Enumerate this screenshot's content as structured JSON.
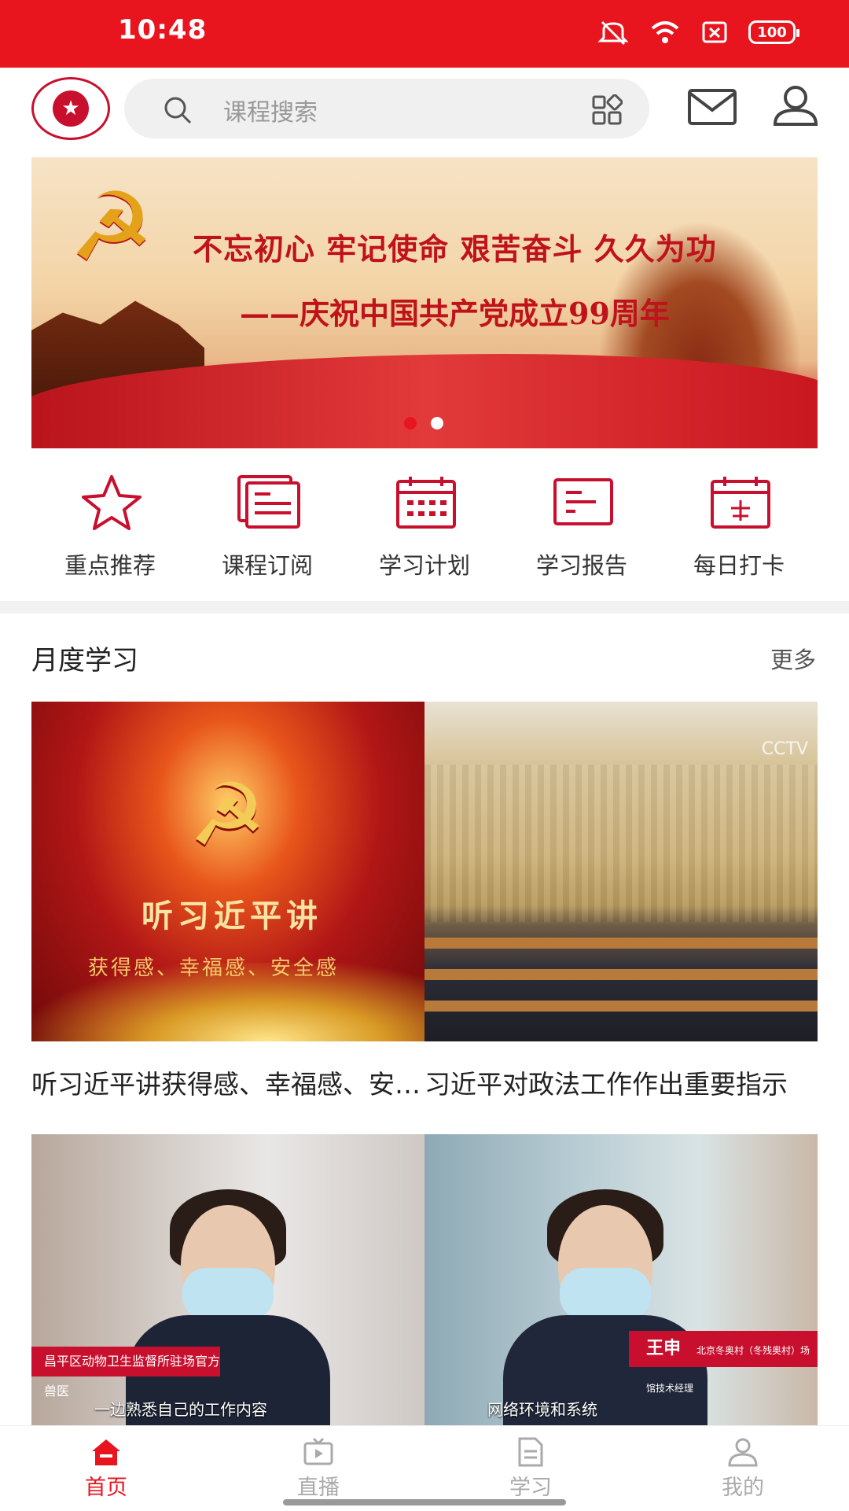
{
  "status_bar": {
    "time": "10:48",
    "battery": "100"
  },
  "header": {
    "search_placeholder": "课程搜索"
  },
  "quick_links": [
    {
      "label": "重点推荐",
      "icon": "star-icon"
    },
    {
      "label": "课程订阅",
      "icon": "subscription-icon"
    },
    {
      "label": "学习计划",
      "icon": "calendar-icon"
    },
    {
      "label": "学习报告",
      "icon": "report-icon"
    },
    {
      "label": "每日打卡",
      "icon": "checkin-icon"
    }
  ],
  "banner": {
    "line1": "不忘初心 牢记使命 艰苦奋斗 久久为功",
    "line2": "——庆祝中国共产党成立99周年",
    "slides": 2,
    "active_slide": 1
  },
  "section": {
    "title": "月度学习",
    "more": "更多"
  },
  "videos": [
    {
      "title": "听习近平讲获得感、幸福感、安全感",
      "overlay_text": "听习近平讲",
      "overlay_sub": "获得感、幸福感、安全感"
    },
    {
      "title": "习近平对政法工作作出重要指示"
    },
    {
      "caption": "一边熟悉自己的工作内容",
      "tag": "昌平区动物卫生监督所驻场官方兽医"
    },
    {
      "caption": "网络环境和系统",
      "name": "王申",
      "name_sub": "北京冬奥村（冬残奥村）场馆技术经理"
    }
  ],
  "tabs": [
    {
      "label": "首页",
      "icon": "home-icon",
      "active": true
    },
    {
      "label": "直播",
      "icon": "live-icon",
      "active": false
    },
    {
      "label": "学习",
      "icon": "study-icon",
      "active": false
    },
    {
      "label": "我的",
      "icon": "profile-icon",
      "active": false
    }
  ],
  "colors": {
    "primary": "#e8151f",
    "banner_text": "#c0121b"
  }
}
